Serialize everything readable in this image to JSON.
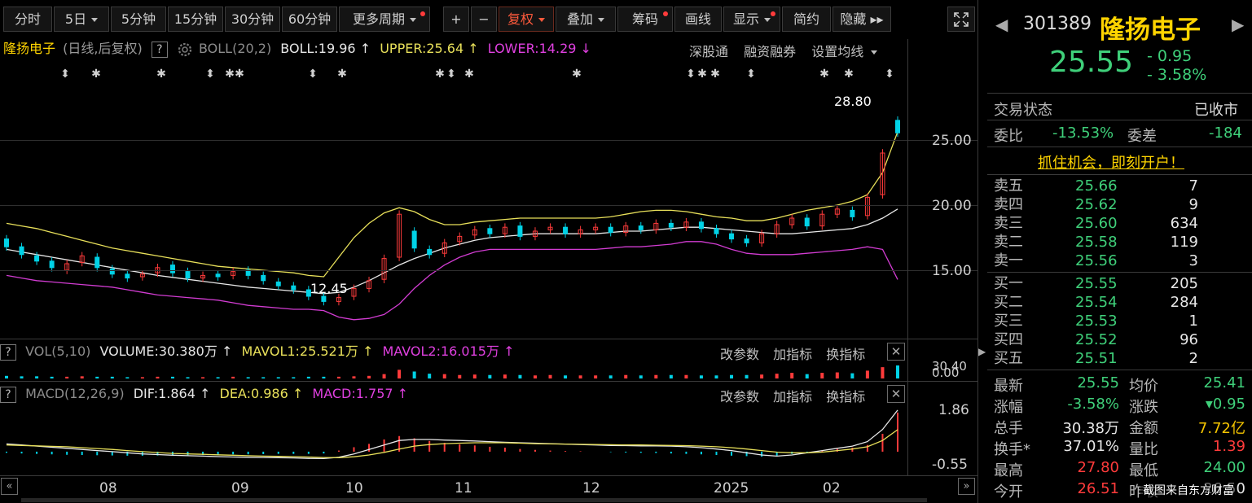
{
  "toolbar": {
    "items": [
      {
        "label": "分时"
      },
      {
        "label": "5日",
        "caret": true
      },
      {
        "label": "5分钟"
      },
      {
        "label": "15分钟"
      },
      {
        "label": "30分钟"
      },
      {
        "label": "60分钟"
      },
      {
        "label": "更多周期",
        "caret": true,
        "dot": true
      },
      {
        "label": "+"
      },
      {
        "label": "−"
      },
      {
        "label": "复权",
        "caret": true,
        "highlight": true
      },
      {
        "label": "叠加",
        "caret": true
      },
      {
        "label": "筹码",
        "dot": true
      },
      {
        "label": "画线"
      },
      {
        "label": "显示",
        "caret": true,
        "dot": true
      },
      {
        "label": "简约"
      },
      {
        "label": "隐藏 ▸▸"
      }
    ],
    "fullscreen_icon": "fullscreen-icon"
  },
  "main": {
    "stock_name": "隆扬电子",
    "mode": "(日线,后复权)",
    "help": "?",
    "indicator": "BOLL(20,2)",
    "boll": "BOLL:19.96",
    "upper": "UPPER:25.64",
    "lower": "LOWER:14.29",
    "links": [
      "深股通",
      "融资融券",
      "设置均线"
    ],
    "high_label": "28.80",
    "low_label": "12.45",
    "y_ticks": [
      "25.00",
      "20.00",
      "15.00"
    ],
    "colors": {
      "up": "#ff3b3b",
      "down": "#00d2e6",
      "mid": "#e8e8e8",
      "upper": "#e8e05a",
      "lower": "#d23cd2"
    }
  },
  "vol": {
    "help": "?",
    "title": "VOL(5,10)",
    "volume": "VOLUME:30.380万",
    "mavol1": "MAVOL1:25.521万",
    "mavol2": "MAVOL2:16.015万",
    "actions": [
      "改参数",
      "加指标",
      "换指标"
    ],
    "y_ticks": [
      "30.40",
      "0.00"
    ]
  },
  "macd": {
    "help": "?",
    "title": "MACD(12,26,9)",
    "dif": "DIF:1.864",
    "dea": "DEA:0.986",
    "macd": "MACD:1.757",
    "actions": [
      "改参数",
      "加指标",
      "换指标"
    ],
    "y_ticks": [
      "1.86",
      "-0.55"
    ]
  },
  "x_axis": {
    "labels": [
      "08",
      "09",
      "10",
      "11",
      "12",
      "2025",
      "02"
    ]
  },
  "quote": {
    "code": "301389",
    "name": "隆扬电子",
    "price": "25.55",
    "change": "- 0.95",
    "change_pct": "- 3.58%",
    "status_label": "交易状态",
    "status": "已收市",
    "weibi_label": "委比",
    "weibi": "-13.53%",
    "weicha_label": "委差",
    "weicha": "-184",
    "promo": "抓住机会，即刻开户！",
    "asks": [
      {
        "label": "卖五",
        "price": "25.66",
        "vol": "7"
      },
      {
        "label": "卖四",
        "price": "25.62",
        "vol": "9"
      },
      {
        "label": "卖三",
        "price": "25.60",
        "vol": "634"
      },
      {
        "label": "卖二",
        "price": "25.58",
        "vol": "119"
      },
      {
        "label": "卖一",
        "price": "25.56",
        "vol": "3"
      }
    ],
    "bids": [
      {
        "label": "买一",
        "price": "25.55",
        "vol": "205"
      },
      {
        "label": "买二",
        "price": "25.54",
        "vol": "284"
      },
      {
        "label": "买三",
        "price": "25.53",
        "vol": "1"
      },
      {
        "label": "买四",
        "price": "25.52",
        "vol": "96"
      },
      {
        "label": "买五",
        "price": "25.51",
        "vol": "2"
      }
    ],
    "stats": [
      {
        "l1": "最新",
        "v1": "25.55",
        "c1": "grn",
        "l2": "均价",
        "v2": "25.41",
        "c2": "grn"
      },
      {
        "l1": "涨幅",
        "v1": "-3.58%",
        "c1": "grn",
        "l2": "涨跌",
        "v2": "▾0.95",
        "c2": "grn"
      },
      {
        "l1": "总手",
        "v1": "30.38万",
        "c1": "wht",
        "l2": "金额",
        "v2": "7.72亿",
        "c2": "yel"
      },
      {
        "l1": "换手*",
        "v1": "37.01%",
        "c1": "wht",
        "l2": "量比",
        "v2": "1.39",
        "c2": "red"
      },
      {
        "l1": "最高",
        "v1": "27.80",
        "c1": "red",
        "l2": "最低",
        "v2": "24.00",
        "c2": "grn"
      },
      {
        "l1": "今开",
        "v1": "26.51",
        "c1": "red",
        "l2": "昨收",
        "v2": "26.50",
        "c2": "wht"
      }
    ]
  },
  "watermark": "截图来自东方财富",
  "chart_data": {
    "type": "candlestick",
    "boll_mid": [
      16.6,
      16.4,
      16.2,
      16.0,
      15.8,
      15.6,
      15.4,
      15.2,
      15.0,
      14.8,
      14.6,
      14.45,
      14.3,
      14.15,
      14.0,
      13.85,
      13.7,
      13.6,
      13.5,
      13.4,
      13.3,
      13.2,
      13.3,
      13.7,
      14.2,
      14.8,
      15.4,
      15.9,
      16.3,
      16.7,
      17.0,
      17.3,
      17.5,
      17.6,
      17.7,
      17.8,
      17.8,
      17.8,
      17.8,
      17.8,
      17.9,
      18.0,
      18.0,
      18.1,
      18.2,
      18.3,
      18.3,
      18.2,
      18.1,
      18.0,
      17.9,
      17.8,
      17.8,
      17.9,
      18.0,
      18.1,
      18.2,
      18.5,
      19.0,
      19.7
    ],
    "boll_upper": [
      18.6,
      18.4,
      18.2,
      17.9,
      17.6,
      17.3,
      17.0,
      16.7,
      16.5,
      16.3,
      16.1,
      15.9,
      15.7,
      15.5,
      15.3,
      15.2,
      15.1,
      15.0,
      14.9,
      14.8,
      14.6,
      14.5,
      16.0,
      17.5,
      18.6,
      19.4,
      19.8,
      19.5,
      18.9,
      18.5,
      18.5,
      18.7,
      18.8,
      18.9,
      19.0,
      19.0,
      19.0,
      19.0,
      19.0,
      19.0,
      19.1,
      19.3,
      19.5,
      19.6,
      19.6,
      19.5,
      19.3,
      19.1,
      19.0,
      18.8,
      18.8,
      19.0,
      19.3,
      19.6,
      19.8,
      20.0,
      20.3,
      20.8,
      22.5,
      25.64
    ],
    "boll_lower": [
      14.6,
      14.4,
      14.2,
      14.1,
      14.0,
      13.9,
      13.8,
      13.7,
      13.5,
      13.3,
      13.1,
      13.0,
      12.9,
      12.8,
      12.7,
      12.5,
      12.3,
      12.2,
      12.1,
      12.0,
      12.0,
      11.9,
      11.4,
      11.2,
      11.3,
      11.6,
      12.4,
      13.6,
      14.6,
      15.4,
      16.0,
      16.4,
      16.6,
      16.6,
      16.6,
      16.6,
      16.6,
      16.6,
      16.6,
      16.6,
      16.7,
      16.8,
      16.8,
      16.9,
      17.0,
      17.2,
      17.2,
      17.0,
      16.6,
      16.3,
      16.2,
      16.2,
      16.2,
      16.3,
      16.4,
      16.5,
      16.6,
      16.8,
      16.6,
      14.29
    ],
    "candles": [
      {
        "o": 17.4,
        "c": 16.8
      },
      {
        "o": 16.8,
        "c": 16.2
      },
      {
        "o": 16.1,
        "c": 15.7
      },
      {
        "o": 15.7,
        "c": 15.2
      },
      {
        "o": 15.0,
        "c": 15.5
      },
      {
        "o": 15.6,
        "c": 16.1
      },
      {
        "o": 16.0,
        "c": 15.2
      },
      {
        "o": 15.1,
        "c": 14.7
      },
      {
        "o": 14.7,
        "c": 14.4
      },
      {
        "o": 14.5,
        "c": 14.7
      },
      {
        "o": 14.8,
        "c": 15.2
      },
      {
        "o": 15.4,
        "c": 14.8
      },
      {
        "o": 14.9,
        "c": 14.4
      },
      {
        "o": 14.4,
        "c": 14.6
      },
      {
        "o": 14.7,
        "c": 14.5
      },
      {
        "o": 14.6,
        "c": 14.9
      },
      {
        "o": 15.0,
        "c": 14.6
      },
      {
        "o": 14.6,
        "c": 14.2
      },
      {
        "o": 14.1,
        "c": 13.8
      },
      {
        "o": 13.8,
        "c": 13.5
      },
      {
        "o": 13.5,
        "c": 13.0
      },
      {
        "o": 13.0,
        "c": 12.6
      },
      {
        "o": 12.6,
        "c": 12.9
      },
      {
        "o": 13.0,
        "c": 13.6
      },
      {
        "o": 13.6,
        "c": 14.2
      },
      {
        "o": 14.3,
        "c": 15.9
      },
      {
        "o": 16.0,
        "c": 19.3
      },
      {
        "o": 18.0,
        "c": 16.7
      },
      {
        "o": 16.6,
        "c": 16.2
      },
      {
        "o": 16.3,
        "c": 17.1
      },
      {
        "o": 17.2,
        "c": 17.6
      },
      {
        "o": 17.7,
        "c": 18.1
      },
      {
        "o": 18.2,
        "c": 17.8
      },
      {
        "o": 17.8,
        "c": 18.3
      },
      {
        "o": 18.4,
        "c": 17.6
      },
      {
        "o": 17.6,
        "c": 18.0
      },
      {
        "o": 18.1,
        "c": 18.3
      },
      {
        "o": 18.3,
        "c": 17.8
      },
      {
        "o": 17.8,
        "c": 18.1
      },
      {
        "o": 18.1,
        "c": 18.3
      },
      {
        "o": 18.3,
        "c": 17.9
      },
      {
        "o": 17.9,
        "c": 18.4
      },
      {
        "o": 18.4,
        "c": 18.1
      },
      {
        "o": 18.1,
        "c": 18.6
      },
      {
        "o": 18.6,
        "c": 18.3
      },
      {
        "o": 18.3,
        "c": 18.7
      },
      {
        "o": 18.7,
        "c": 18.2
      },
      {
        "o": 18.2,
        "c": 17.8
      },
      {
        "o": 17.8,
        "c": 17.4
      },
      {
        "o": 17.4,
        "c": 17.1
      },
      {
        "o": 17.1,
        "c": 17.8
      },
      {
        "o": 17.8,
        "c": 18.5
      },
      {
        "o": 18.5,
        "c": 19.0
      },
      {
        "o": 19.0,
        "c": 18.4
      },
      {
        "o": 18.4,
        "c": 19.3
      },
      {
        "o": 19.3,
        "c": 19.7
      },
      {
        "o": 19.6,
        "c": 19.1
      },
      {
        "o": 19.2,
        "c": 20.6
      },
      {
        "o": 20.8,
        "c": 24.0
      },
      {
        "o": 26.51,
        "c": 25.55
      }
    ],
    "volume": [
      0.6,
      0.5,
      0.5,
      0.4,
      0.4,
      0.5,
      0.4,
      0.4,
      0.3,
      0.3,
      0.4,
      0.4,
      0.3,
      0.3,
      0.3,
      0.4,
      0.3,
      0.3,
      0.3,
      0.3,
      0.4,
      0.4,
      0.4,
      0.5,
      0.6,
      1.0,
      2.0,
      1.6,
      1.1,
      1.0,
      0.8,
      0.9,
      0.8,
      0.9,
      0.8,
      0.7,
      0.8,
      0.7,
      0.7,
      0.7,
      0.7,
      0.8,
      0.7,
      0.8,
      0.8,
      0.8,
      0.7,
      0.7,
      0.8,
      0.8,
      0.9,
      1.1,
      1.3,
      1.0,
      1.3,
      1.4,
      1.2,
      1.8,
      2.6,
      3.0
    ],
    "macd_hist": [
      -0.05,
      -0.08,
      -0.1,
      -0.12,
      -0.14,
      -0.15,
      -0.16,
      -0.17,
      -0.18,
      -0.18,
      -0.17,
      -0.16,
      -0.16,
      -0.15,
      -0.14,
      -0.12,
      -0.12,
      -0.11,
      -0.1,
      -0.1,
      -0.1,
      -0.08,
      0.05,
      0.2,
      0.35,
      0.55,
      0.7,
      0.6,
      0.48,
      0.4,
      0.33,
      0.28,
      0.22,
      0.18,
      0.12,
      0.08,
      0.05,
      0.03,
      0.02,
      0.0,
      -0.02,
      -0.04,
      -0.05,
      -0.06,
      -0.08,
      -0.1,
      -0.12,
      -0.15,
      -0.18,
      -0.2,
      -0.22,
      -0.18,
      -0.1,
      -0.03,
      0.05,
      0.12,
      0.18,
      0.3,
      0.8,
      1.757
    ],
    "dif": [
      0.35,
      0.3,
      0.25,
      0.2,
      0.15,
      0.1,
      0.05,
      0.0,
      -0.05,
      -0.1,
      -0.13,
      -0.16,
      -0.18,
      -0.2,
      -0.22,
      -0.24,
      -0.25,
      -0.26,
      -0.27,
      -0.28,
      -0.3,
      -0.31,
      -0.25,
      -0.1,
      0.1,
      0.3,
      0.5,
      0.55,
      0.55,
      0.52,
      0.5,
      0.48,
      0.45,
      0.42,
      0.4,
      0.38,
      0.36,
      0.34,
      0.32,
      0.3,
      0.28,
      0.27,
      0.26,
      0.26,
      0.25,
      0.22,
      0.18,
      0.12,
      0.05,
      -0.05,
      -0.15,
      -0.2,
      -0.15,
      -0.05,
      0.05,
      0.15,
      0.25,
      0.45,
      1.0,
      1.864
    ],
    "dea": [
      0.3,
      0.28,
      0.26,
      0.24,
      0.22,
      0.18,
      0.14,
      0.1,
      0.05,
      0.0,
      -0.04,
      -0.08,
      -0.1,
      -0.12,
      -0.14,
      -0.16,
      -0.18,
      -0.2,
      -0.21,
      -0.22,
      -0.24,
      -0.26,
      -0.27,
      -0.23,
      -0.15,
      -0.03,
      0.12,
      0.25,
      0.32,
      0.36,
      0.38,
      0.4,
      0.4,
      0.4,
      0.38,
      0.36,
      0.35,
      0.34,
      0.33,
      0.32,
      0.31,
      0.3,
      0.3,
      0.29,
      0.28,
      0.27,
      0.25,
      0.22,
      0.18,
      0.12,
      0.05,
      -0.02,
      -0.05,
      -0.05,
      -0.02,
      0.05,
      0.12,
      0.22,
      0.5,
      0.986
    ],
    "ylim_price": [
      10.5,
      30.0
    ],
    "ylim_macd": [
      -0.9,
      2.3
    ]
  }
}
